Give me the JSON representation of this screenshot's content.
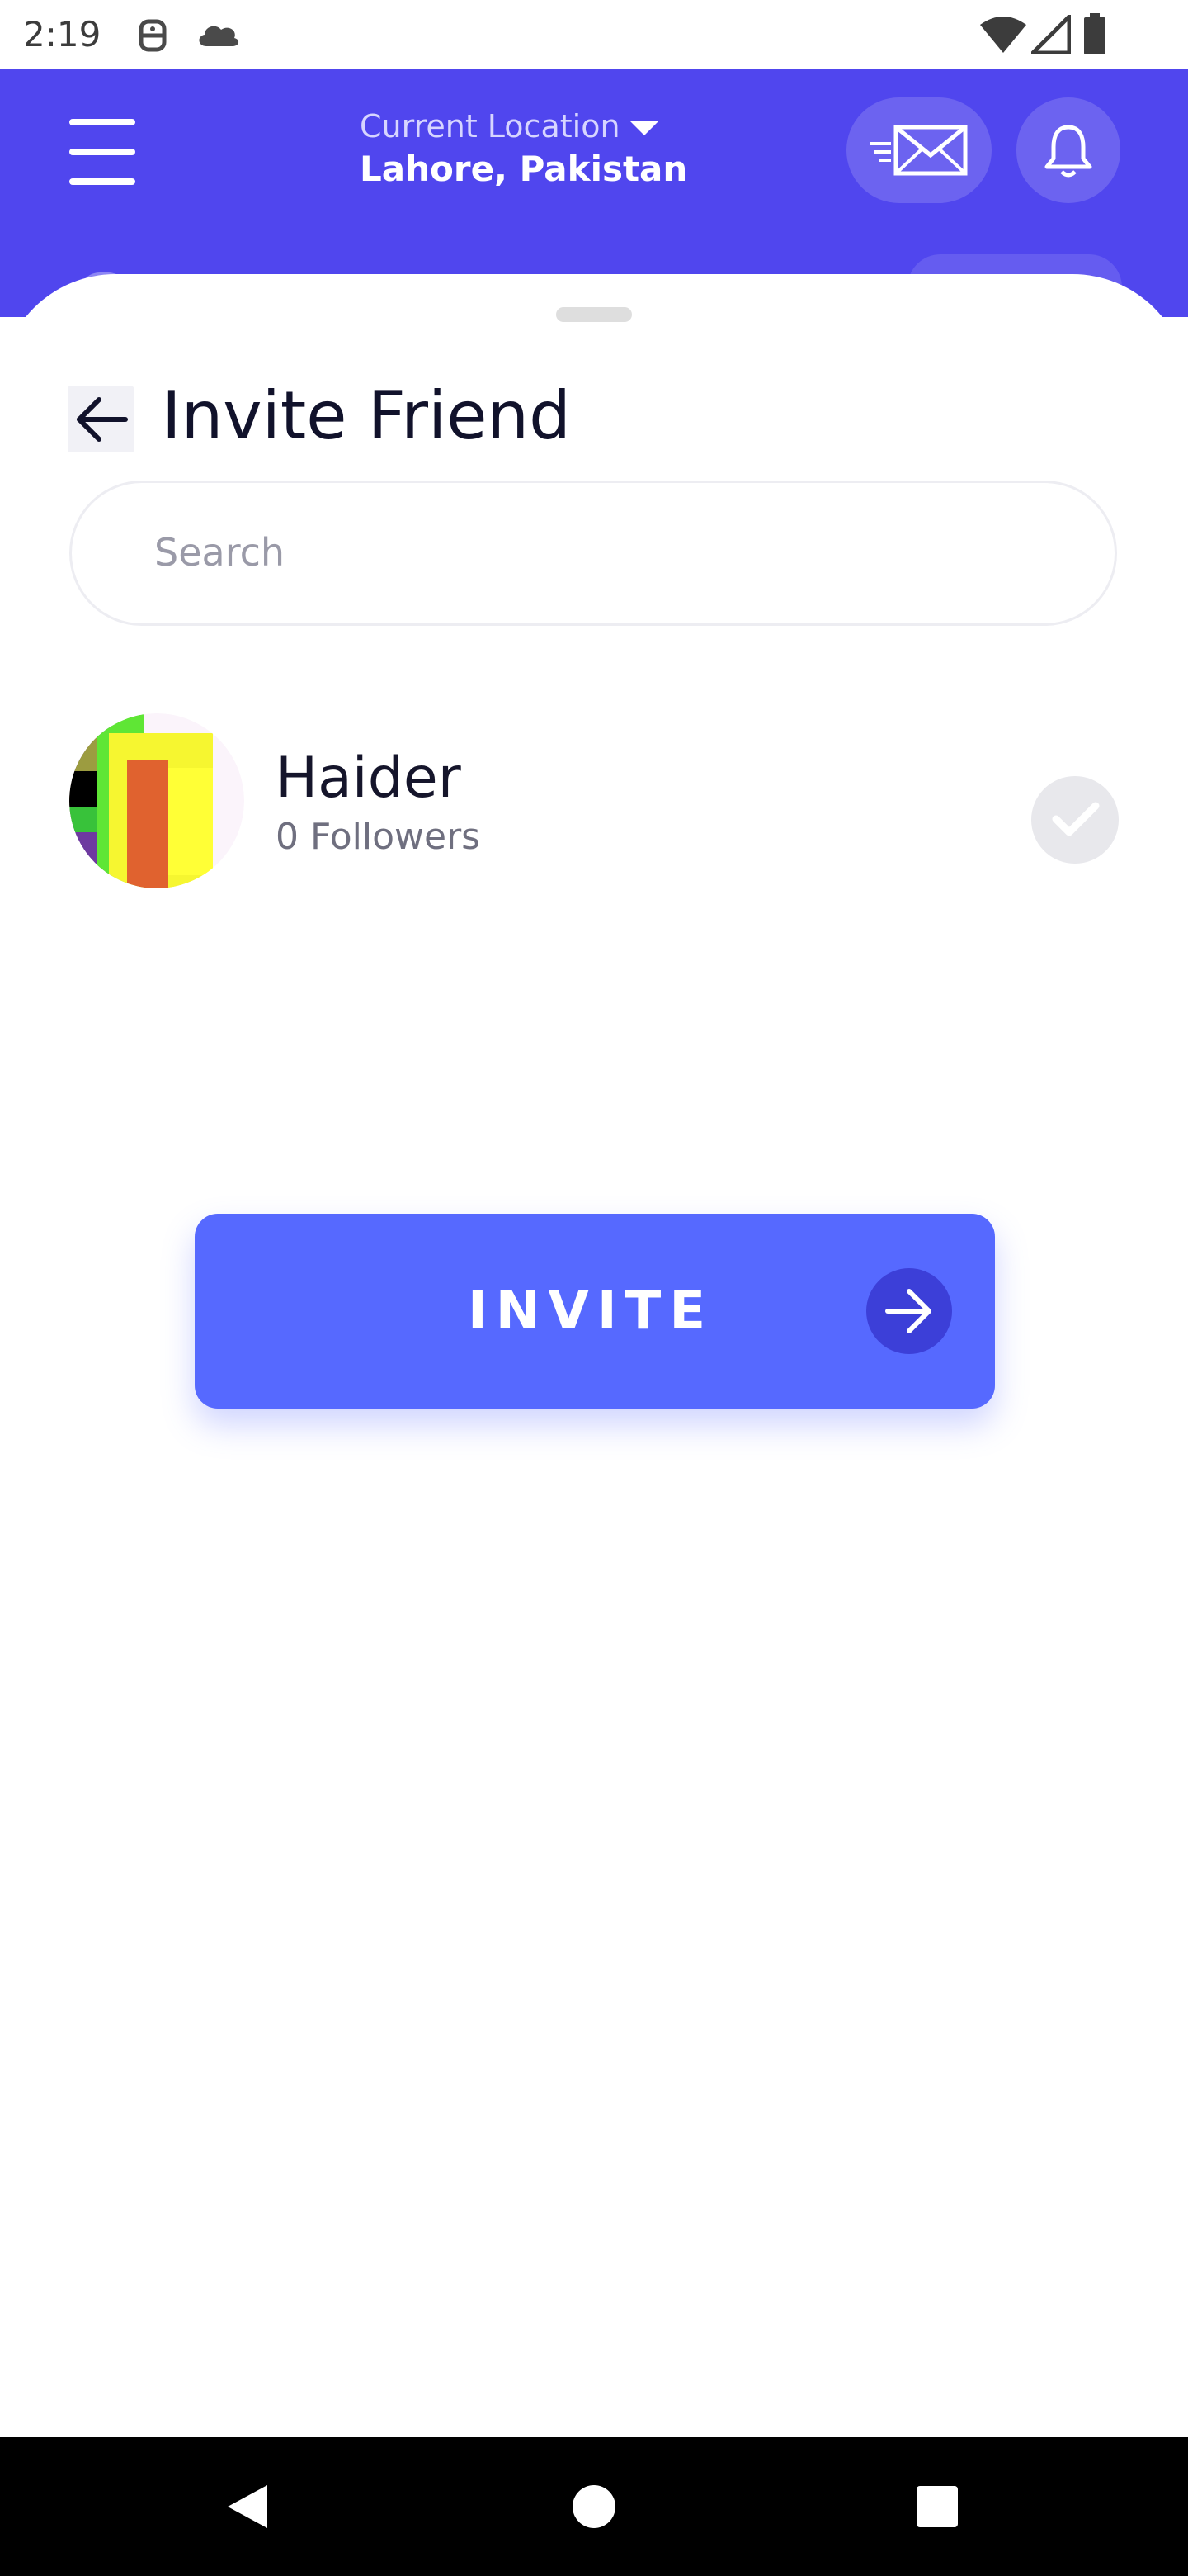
{
  "status_bar": {
    "time": "2:19",
    "icons": [
      "android-debug-icon",
      "cloud-icon",
      "wifi-icon",
      "cellular-signal-icon",
      "battery-icon"
    ]
  },
  "header": {
    "menu_icon": "hamburger-menu-icon",
    "location_label": "Current Location",
    "location_value": "Lahore, Pakistan",
    "messages_icon": "envelope-icon",
    "notifications_icon": "bell-icon",
    "accent_color": "#5046ee"
  },
  "invite_sheet": {
    "back_icon": "arrow-left-icon",
    "title": "Invite Friend",
    "search": {
      "placeholder": "Search",
      "value": ""
    },
    "friends": [
      {
        "name": "Haider",
        "followers": "0 Followers",
        "selected": false
      }
    ],
    "invite_button": {
      "label": "INVITE",
      "icon": "arrow-right-icon",
      "color": "#5669ff"
    }
  },
  "nav_bar": {
    "buttons": [
      "back-triangle-icon",
      "home-circle-icon",
      "recents-square-icon"
    ]
  }
}
